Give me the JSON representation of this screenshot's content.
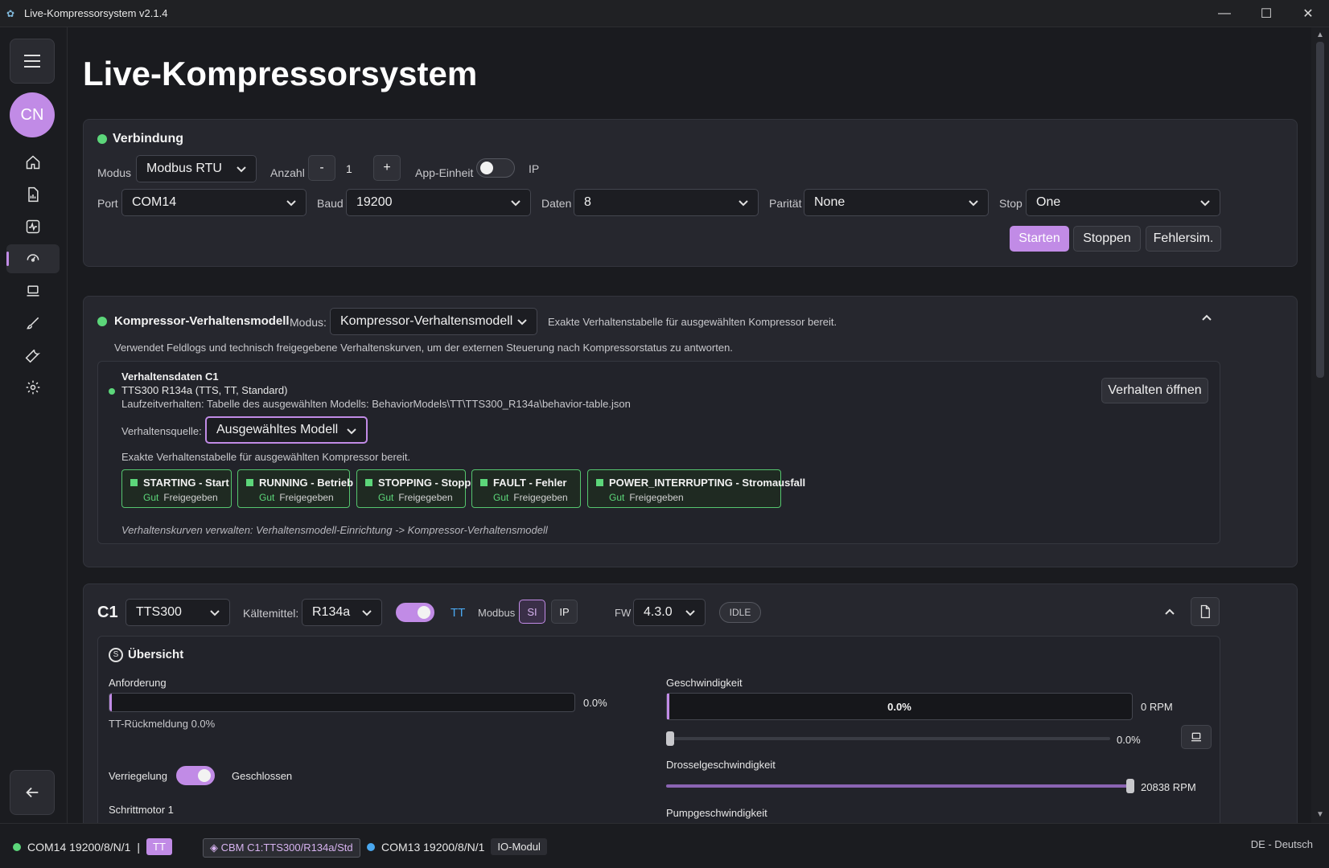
{
  "window": {
    "title": "Live-Kompressorsystem v2.1.4"
  },
  "sidebar": {
    "avatar_initials": "CN"
  },
  "page": {
    "title": "Live-Kompressorsystem"
  },
  "connection": {
    "title": "Verbindung",
    "mode_label": "Modus",
    "mode_value": "Modbus RTU",
    "count_label": "Anzahl",
    "count_minus": "-",
    "count_value": "1",
    "count_plus": "+",
    "app_unit_label": "App-Einheit",
    "ip_label": "IP",
    "port_label": "Port",
    "port_value": "COM14",
    "baud_label": "Baud",
    "baud_value": "19200",
    "data_label": "Daten",
    "data_value": "8",
    "parity_label": "Parität",
    "parity_value": "None",
    "stop_label": "Stop",
    "stop_value": "One",
    "start_button": "Starten",
    "stop_button": "Stoppen",
    "faultsim_button": "Fehlersim."
  },
  "behavior": {
    "title": "Kompressor-Verhaltensmodell",
    "mode_label": "Modus:",
    "mode_value": "Kompressor-Verhaltensmodell",
    "ready_text": "Exakte Verhaltenstabelle für ausgewählten Kompressor bereit.",
    "description": "Verwendet Feldlogs und technisch freigegebene Verhaltenskurven, um der externen Steuerung nach Kompressorstatus zu antworten.",
    "data_title": "Verhaltensdaten C1",
    "model_line": "TTS300 R134a (TTS, TT, Standard)",
    "runtime_line": "Laufzeitverhalten: Tabelle des ausgewählten Modells: BehaviorModels\\TT\\TTS300_R134a\\behavior-table.json",
    "open_button": "Verhalten öffnen",
    "source_label": "Verhaltensquelle:",
    "source_value": "Ausgewähltes Modell",
    "source_ready": "Exakte Verhaltenstabelle für ausgewählten Kompressor bereit.",
    "states": [
      {
        "name": "STARTING - Start",
        "quality": "Gut",
        "status": "Freigegeben"
      },
      {
        "name": "RUNNING - Betrieb",
        "quality": "Gut",
        "status": "Freigegeben"
      },
      {
        "name": "STOPPING - Stopp",
        "quality": "Gut",
        "status": "Freigegeben"
      },
      {
        "name": "FAULT - Fehler",
        "quality": "Gut",
        "status": "Freigegeben"
      },
      {
        "name": "POWER_INTERRUPTING - Stromausfall",
        "quality": "Gut",
        "status": "Freigegeben"
      }
    ],
    "footer_hint": "Verhaltenskurven verwalten: Verhaltensmodell-Einrichtung -> Kompressor-Verhaltensmodell"
  },
  "compressor": {
    "id": "C1",
    "model": "TTS300",
    "refrigerant_label": "Kältemittel:",
    "refrigerant_value": "R134a",
    "tt_label": "TT",
    "modbus_label": "Modbus",
    "si_label": "SI",
    "ip_label": "IP",
    "fw_label": "FW",
    "fw_value": "4.3.0",
    "state_badge": "IDLE",
    "overview_title": "Übersicht",
    "demand_label": "Anforderung",
    "demand_value": "0.0%",
    "demand_fraction": 0.0,
    "tt_feedback": "TT-Rückmeldung 0.0%",
    "lock_label": "Verriegelung",
    "lock_state": "Geschlossen",
    "stepper_label": "Schrittmotor 1",
    "speed_label": "Geschwindigkeit",
    "speed_percent": "0.0%",
    "speed_rpm": "0 RPM",
    "speed_slider_value": "0.0%",
    "throttle_label": "Drosselgeschwindigkeit",
    "throttle_rpm": "20838 RPM",
    "throttle_fraction": 1.0,
    "pump_label": "Pumpgeschwindigkeit"
  },
  "statusbar": {
    "port1": "COM14 19200/8/N/1",
    "separator": "|",
    "tt_chip": "TT",
    "cbm_chip": "CBM C1:TTS300/R134a/Std",
    "port2": "COM13 19200/8/N/1",
    "io_chip": "IO-Modul",
    "language": "DE - Deutsch"
  },
  "colors": {
    "accent": "#c18be6",
    "ok": "#5cd67a",
    "info": "#4aa8f0"
  }
}
